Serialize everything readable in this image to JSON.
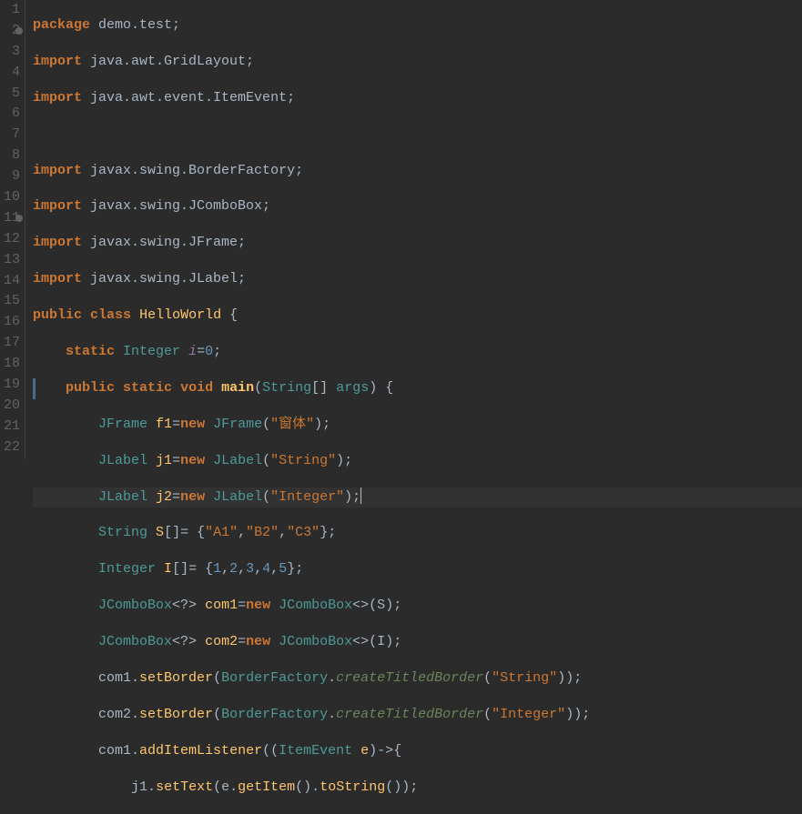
{
  "gutter": {
    "lines": [
      "1",
      "2",
      "3",
      "4",
      "5",
      "6",
      "7",
      "8",
      "9",
      "10",
      "11",
      "12",
      "13",
      "14",
      "15",
      "16",
      "17",
      "18",
      "19",
      "20",
      "21",
      "22"
    ],
    "markers": [
      2,
      11
    ]
  },
  "code": {
    "l1": {
      "kw_package": "package",
      "pkg": "demo.test;"
    },
    "l2": {
      "kw_import": "import",
      "path": "java.awt.GridLayout;"
    },
    "l3": {
      "kw_import": "import",
      "path": "java.awt.event.ItemEvent;"
    },
    "l5": {
      "kw_import": "import",
      "path": "javax.swing.BorderFactory;"
    },
    "l6": {
      "kw_import": "import",
      "path": "javax.swing.JComboBox;"
    },
    "l7": {
      "kw_import": "import",
      "path": "javax.swing.JFrame;"
    },
    "l8": {
      "kw_import": "import",
      "path": "javax.swing.JLabel;"
    },
    "l9": {
      "kw_public": "public",
      "kw_class": "class",
      "classname": "HelloWorld",
      "brace": "{"
    },
    "l10": {
      "kw_static": "static",
      "type": "Integer",
      "var": "i",
      "eq": "=",
      "val": "0",
      "semi": ";"
    },
    "l11": {
      "kw_public": "public",
      "kw_static": "static",
      "kw_void": "void",
      "method": "main",
      "paren_o": "(",
      "ptype": "String",
      "arr": "[]",
      "pname": "args",
      "paren_c": ")",
      "brace": "{"
    },
    "l12": {
      "type": "JFrame",
      "var": "f1",
      "eq": "=",
      "kw_new": "new",
      "ctor": "JFrame",
      "paren_o": "(",
      "str": "\"窗体\"",
      "paren_c": ")",
      "semi": ";"
    },
    "l13": {
      "type": "JLabel",
      "var": "j1",
      "eq": "=",
      "kw_new": "new",
      "ctor": "JLabel",
      "paren_o": "(",
      "str": "\"String\"",
      "paren_c": ")",
      "semi": ";"
    },
    "l14": {
      "type": "JLabel",
      "var": "j2",
      "eq": "=",
      "kw_new": "new",
      "ctor": "JLabel",
      "paren_o": "(",
      "str": "\"Integer\"",
      "paren_c": ")",
      "semi": ";"
    },
    "l15": {
      "type": "String",
      "var": "S",
      "arr": "[]",
      "eq": "=",
      "brace_o": " {",
      "s1": "\"A1\"",
      "c1": ",",
      "s2": "\"B2\"",
      "c2": ",",
      "s3": "\"C3\"",
      "brace_c": "}",
      "semi": ";"
    },
    "l16": {
      "type": "Integer",
      "var": "I",
      "arr": "[]",
      "eq": "=",
      "brace_o": " {",
      "n1": "1",
      "c1": ",",
      "n2": "2",
      "c2": ",",
      "n3": "3",
      "c3": ",",
      "n4": "4",
      "c4": ",",
      "n5": "5",
      "brace_c": "}",
      "semi": ";"
    },
    "l17": {
      "type": "JComboBox",
      "gen": "<?>",
      "var": "com1",
      "eq": "=",
      "kw_new": "new",
      "ctor": "JComboBox",
      "gen2": "<>",
      "paren_o": "(",
      "arg": "S",
      "paren_c": ")",
      "semi": ";"
    },
    "l18": {
      "type": "JComboBox",
      "gen": "<?>",
      "var": "com2",
      "eq": "=",
      "kw_new": "new",
      "ctor": "JComboBox",
      "gen2": "<>",
      "paren_o": "(",
      "arg": "I",
      "paren_c": ")",
      "semi": ";"
    },
    "l19": {
      "obj": "com1",
      "dot": ".",
      "meth": "setBorder",
      "paren_o": "(",
      "cls": "BorderFactory",
      "dot2": ".",
      "meth2": "createTitledBorder",
      "paren_o2": "(",
      "str": "\"String\"",
      "paren_c2": ")",
      "paren_c": ")",
      "semi": ";"
    },
    "l20": {
      "obj": "com2",
      "dot": ".",
      "meth": "setBorder",
      "paren_o": "(",
      "cls": "BorderFactory",
      "dot2": ".",
      "meth2": "createTitledBorder",
      "paren_o2": "(",
      "str": "\"Integer\"",
      "paren_c2": ")",
      "paren_c": ")",
      "semi": ";"
    },
    "l21": {
      "obj": "com1",
      "dot": ".",
      "meth": "addItemListener",
      "paren_o": "(",
      "paren_o2": "(",
      "ptype": "ItemEvent",
      "pname": "e",
      "paren_c2": ")",
      "arrow": "->",
      "brace": "{"
    },
    "l22": {
      "obj": "j1",
      "dot": ".",
      "meth": "setText",
      "paren_o": "(",
      "arg1": "e",
      "dot2": ".",
      "meth2": "getItem",
      "paren_o2": "(",
      "paren_c2": ")",
      "dot3": ".",
      "meth3": "toString",
      "paren_o3": "(",
      "paren_c3": ")",
      "paren_c": ")",
      "semi": ";"
    }
  }
}
